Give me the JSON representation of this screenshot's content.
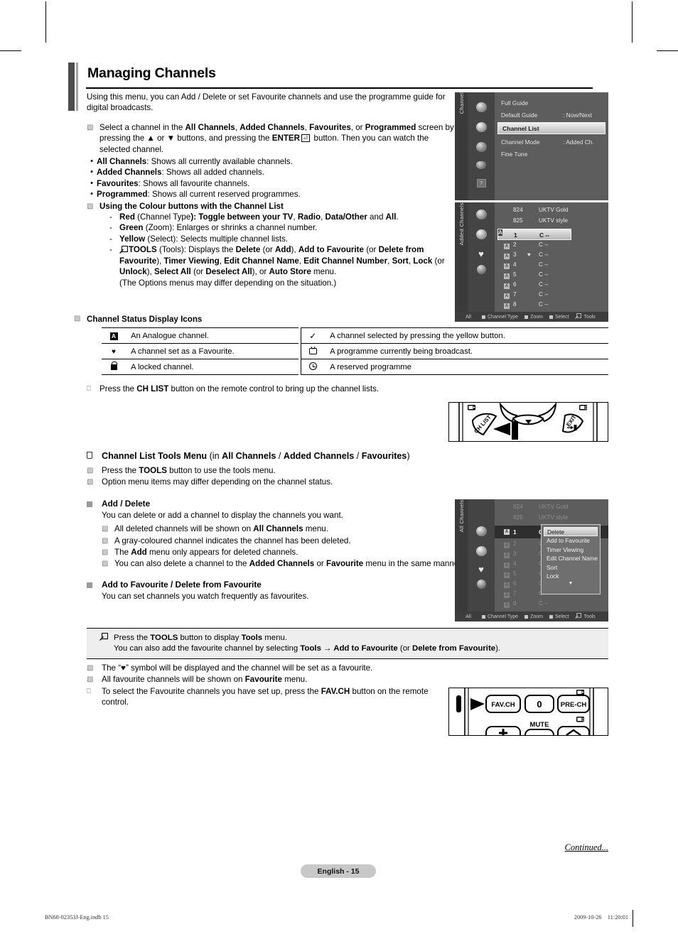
{
  "page": {
    "title": "Managing Channels",
    "intro": "Using this menu, you can Add / Delete or set Favourite channels and use the programme guide for digital broadcasts.",
    "continued": "Continued...",
    "page_label": "English - 15",
    "footer_left": "BN68-02353J-Eng.indb   15",
    "footer_right": "2009-10-26      11:20:01"
  },
  "notes": {
    "select_channel": {
      "p1": "Select a channel in the ",
      "b1": "All Channels",
      "p2": ", ",
      "b2": "Added Channels",
      "p3": ", ",
      "b3": "Favourites",
      "p4": ", or ",
      "b4": "Programmed",
      "p5": " screen by pressing the ▲ or ▼ buttons, and pressing the ",
      "b5": "ENTER",
      "p6": " button. Then you can watch the selected channel."
    }
  },
  "bullets": [
    {
      "term": "All Channels",
      "desc": ": Shows all currently available channels."
    },
    {
      "term": "Added Channels",
      "desc": ": Shows all added channels."
    },
    {
      "term": "Favourites",
      "desc": ": Shows all favourite channels."
    },
    {
      "term": "Programmed",
      "desc": ": Shows all current reserved programmes."
    }
  ],
  "colour_buttons": {
    "heading": "Using the Colour buttons with the Channel List",
    "items": [
      {
        "b1": "Red",
        "t1": " (Channel Type",
        "b2": "): Toggle between your ",
        "t2": "TV",
        "rest": ", Radio, Data/Other and All."
      },
      {
        "b1": "Green",
        "rest": " (Zoom): Enlarges or shrinks a channel number."
      },
      {
        "b1": "Yellow",
        "rest": " (Select): Selects multiple channel lists."
      }
    ],
    "tools_line": {
      "label": "TOOLS",
      "p1": " (Tools): Displays the ",
      "b1": "Delete",
      "p2": " (or ",
      "b2": "Add",
      "p3": "), ",
      "b3": "Add to Favourite",
      "p4": " (or ",
      "b4": "Delete from Favourite",
      "p5": "), ",
      "b5": "Timer Viewing",
      "p6": ", ",
      "b6": "Edit Channel Name",
      "p7": ", ",
      "b7": "Edit Channel Number",
      "p8": ", ",
      "b8": "Sort",
      "p9": ", ",
      "b9": "Lock",
      "p10": " (or ",
      "b10": "Unlock",
      "p11": "), ",
      "b11": "Select All",
      "p12": " (or ",
      "b12": "Deselect All",
      "p13": "), or ",
      "b13": "Auto Store",
      "p14": " menu.",
      "paren": "(The Options menus may differ depending on the situation.)"
    }
  },
  "status_icons": {
    "heading": "Channel Status Display Icons",
    "rows": [
      {
        "icon_left": "analogue-a",
        "text_left": "An Analogue channel.",
        "icon_right": "checkmark",
        "text_right": "A channel selected by pressing the yellow button."
      },
      {
        "icon_left": "heart",
        "text_left": "A channel set as a Favourite.",
        "icon_right": "tv",
        "text_right": "A programme currently being broadcast."
      },
      {
        "icon_left": "lock",
        "text_left": "A locked channel.",
        "icon_right": "clock",
        "text_right": "A reserved programme"
      }
    ],
    "ch_list_note": {
      "p1": "Press the ",
      "b1": "CH LIST",
      "p2": " button on the remote control to bring up the channel lists."
    }
  },
  "tools_menu_section": {
    "heading_b1": "Channel List Tools Menu",
    "heading_p1": " (in ",
    "heading_b2": "All Channels",
    "heading_p2": " / ",
    "heading_b3": "Added Channels",
    "heading_p3": " / ",
    "heading_b4": "Favourites",
    "heading_p4": ")",
    "note1": {
      "p1": "Press the ",
      "b1": "TOOLS",
      "p2": " button to use the tools menu."
    },
    "note2": "Option menu items may differ depending on the channel status.",
    "add_delete": {
      "title": "Add / Delete",
      "desc": "You can delete or add a channel to display the channels you want.",
      "notes": [
        {
          "p1": "All deleted channels will be shown on ",
          "b1": "All Channels",
          "p2": " menu."
        },
        {
          "p1": "A gray-coloured channel indicates the channel has been deleted."
        },
        {
          "p1": "The ",
          "b1": "Add",
          "p2": " menu only appears for deleted channels."
        },
        {
          "p1": "You can also delete a channel to the ",
          "b1": "Added Channels",
          "p2": " or ",
          "b2": "Favourite",
          "p3": " menu in the same manner."
        }
      ]
    },
    "add_favourite": {
      "title": "Add to Favourite / Delete from Favourite",
      "desc": "You can set channels you watch frequently as favourites."
    },
    "tipbox": {
      "l1_p1": "Press the ",
      "l1_b1": "TOOLS",
      "l1_p2": " button to display ",
      "l1_b2": "Tools",
      "l1_p3": " menu.",
      "l2_p1": "You can also add the favourite channel by selecting ",
      "l2_b1": "Tools",
      "l2_p2": " → ",
      "l2_b2": "Add to Favourite",
      "l2_p3": " (or ",
      "l2_b3": "Delete from Favourite",
      "l2_p4": ")."
    },
    "final_notes": [
      {
        "p1": "The “♥” symbol will be displayed and the channel will be set as a favourite."
      },
      {
        "p1": "All favourite channels will be shown on ",
        "b1": "Favourite",
        "p2": " menu."
      },
      {
        "p1": "To select the Favourite channels you have set up, press the ",
        "b1": "FAV.CH",
        "p2": " button on the remote control."
      }
    ]
  },
  "tv_menu": {
    "rail_label": "Channel",
    "rows": [
      {
        "label": "Full Guide",
        "value": ""
      },
      {
        "label": "Default Guide",
        "value": ": Now/Next"
      },
      {
        "label": "Channel List",
        "value": "",
        "highlight": true
      },
      {
        "label": "Channel Mode",
        "value": ": Added Ch."
      },
      {
        "label": "Fine Tune",
        "value": ""
      }
    ]
  },
  "tv_added": {
    "rail_label": "Added Channels",
    "top_rows": [
      {
        "num": "824",
        "name": "UKTV Gold"
      },
      {
        "num": "825",
        "name": "UKTV style"
      }
    ],
    "rows": [
      {
        "num": "1",
        "name": "C --",
        "highlight": true,
        "fav": false
      },
      {
        "num": "2",
        "name": "C --",
        "fav": false
      },
      {
        "num": "3",
        "name": "C --",
        "fav": true
      },
      {
        "num": "4",
        "name": "C --",
        "fav": false
      },
      {
        "num": "5",
        "name": "C --",
        "fav": false
      },
      {
        "num": "6",
        "name": "C --",
        "fav": false
      },
      {
        "num": "7",
        "name": "C --",
        "fav": false
      },
      {
        "num": "8",
        "name": "C --",
        "fav": false
      }
    ],
    "bar": {
      "all": "All",
      "b1": "Channel Type",
      "b2": "Zoom",
      "b3": "Select",
      "b4": "Tools"
    }
  },
  "tv_all": {
    "rail_label": "All Channels",
    "top_rows": [
      {
        "num": "824",
        "name": "UKTV Gold"
      },
      {
        "num": "825",
        "name": "UKTV style"
      }
    ],
    "rows": [
      {
        "num": "1",
        "name": "C --",
        "highlight": true
      },
      {
        "num": "2",
        "name": "C --"
      },
      {
        "num": "3",
        "name": "C --"
      },
      {
        "num": "4",
        "name": "C --"
      },
      {
        "num": "5",
        "name": "C --"
      },
      {
        "num": "6",
        "name": "C --"
      },
      {
        "num": "7",
        "name": "C --"
      },
      {
        "num": "8",
        "name": "C --"
      }
    ],
    "tools_popup": [
      {
        "label": "Delete",
        "selected": true
      },
      {
        "label": "Add to Favourite"
      },
      {
        "label": "Timer Viewing"
      },
      {
        "label": "Edit Channel Name"
      },
      {
        "label": "Sort"
      },
      {
        "label": "Lock"
      }
    ],
    "bar": {
      "all": "All",
      "b1": "Channel Type",
      "b2": "Zoom",
      "b3": "Select",
      "b4": "Tools"
    }
  },
  "remote_top": {
    "ch_list": "CH LIST",
    "exit": "EXIT"
  },
  "remote_bottom": {
    "fav_ch": "FAV.CH",
    "zero": "0",
    "pre_ch": "PRE-CH",
    "mute": "MUTE"
  },
  "colors": {
    "accent_dark": "#4d4d4d",
    "accent_light": "#a6a6a6",
    "tip_bg": "#eeeeee",
    "pill_bg": "#c8c8c8"
  }
}
